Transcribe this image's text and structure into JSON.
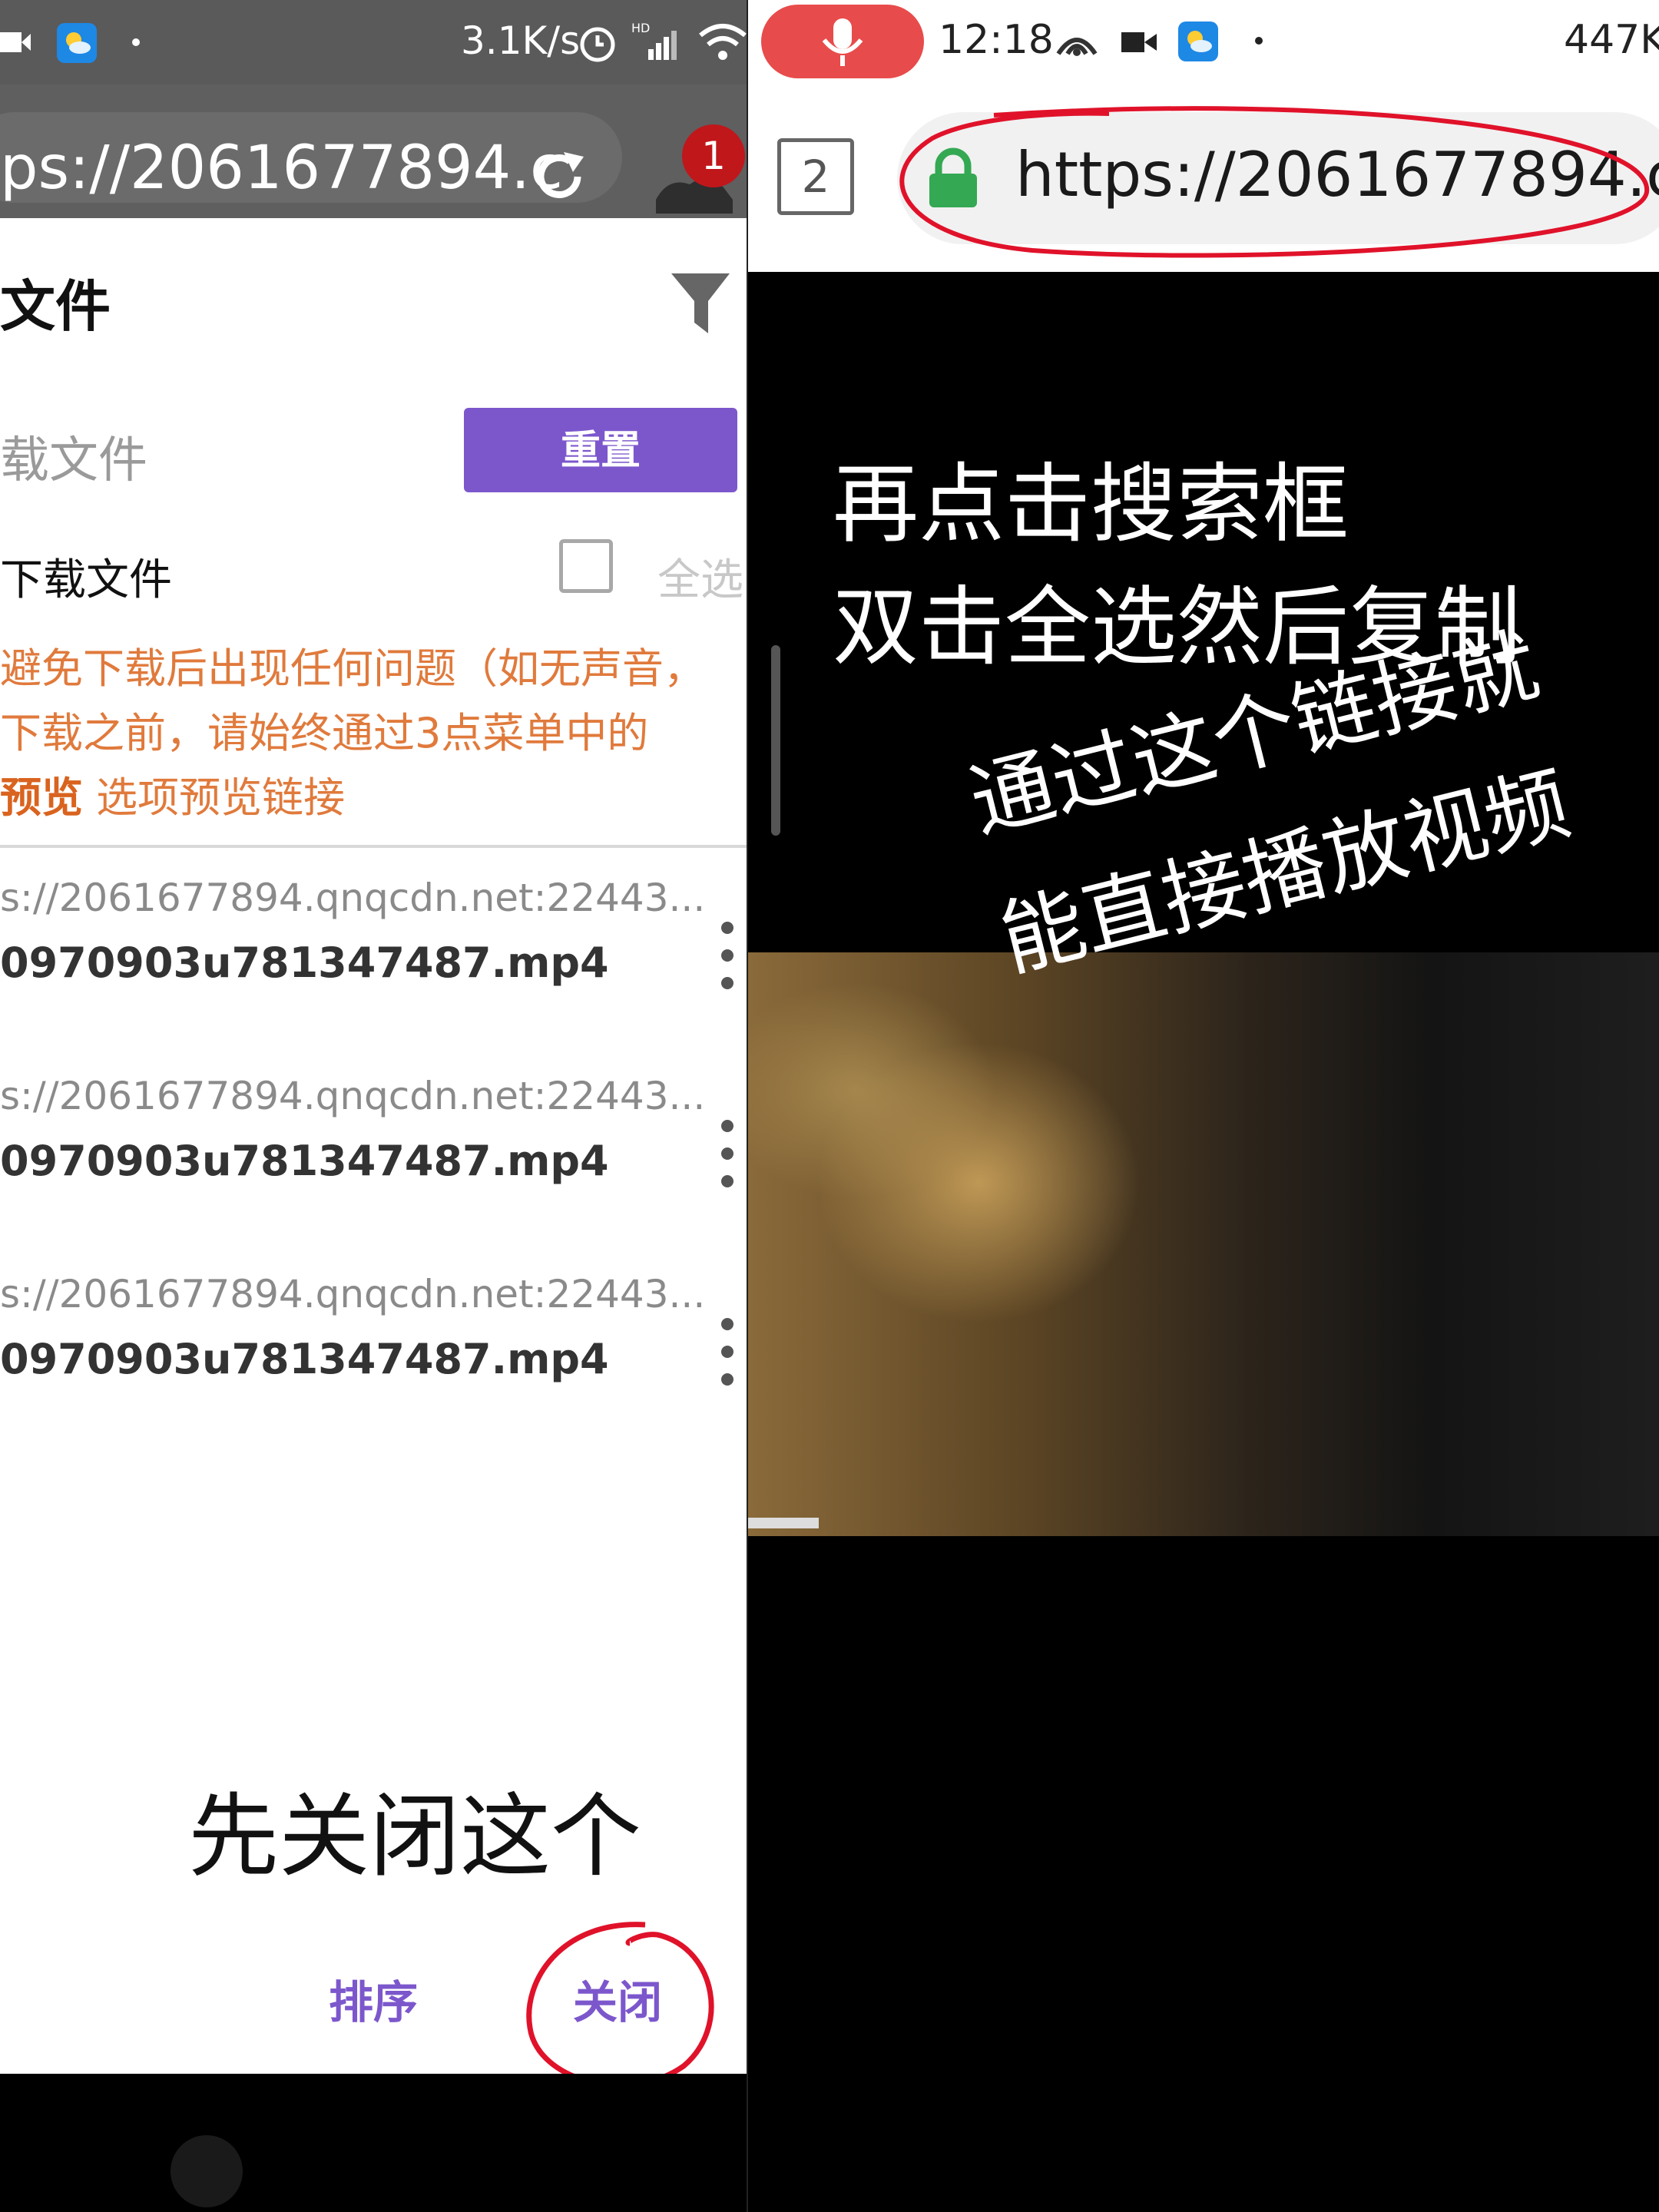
{
  "left": {
    "status": {
      "net_speed": "3.1K/s",
      "network_label": "HD"
    },
    "browser": {
      "url": "ps://2061677894.c",
      "download_badge": "1"
    },
    "sheet": {
      "title": "文件",
      "search_placeholder": "载文件",
      "reset_button": "重置",
      "download_files_label": "下载文件",
      "select_all_label": "全选",
      "warning_line1": "避免下载后出现任何问题（如无声音，",
      "warning_line2": "下载之前，请始终通过3点菜单中的",
      "warning_bold": "预览",
      "warning_line3_rest": " 选项预览链接",
      "files": [
        {
          "url": "s://2061677894.qnqcdn.net:22443...",
          "name": "0970903u781347487.mp4"
        },
        {
          "url": "s://2061677894.qnqcdn.net:22443...",
          "name": "0970903u781347487.mp4"
        },
        {
          "url": "s://2061677894.qnqcdn.net:22443...",
          "name": "0970903u781347487.mp4"
        }
      ],
      "annotation": "先关闭这个",
      "sort_button": "排序",
      "close_button": "关闭"
    }
  },
  "right": {
    "status": {
      "time": "12:18",
      "net_speed": "447K"
    },
    "browser": {
      "tab_count": "2",
      "url": "https://2061677894.c"
    },
    "annotations": {
      "line1": "再点击搜索框",
      "line2": "双击全选然后复制",
      "line3": "通过这个链接就",
      "line4": "能直接播放视频"
    }
  },
  "colors": {
    "accent_purple": "#7c57cc",
    "warning_orange": "#e07a3c",
    "badge_red": "#c0171b",
    "mic_red": "#e84b4b",
    "lock_green": "#34a853",
    "annotation_red": "#e0122a"
  }
}
